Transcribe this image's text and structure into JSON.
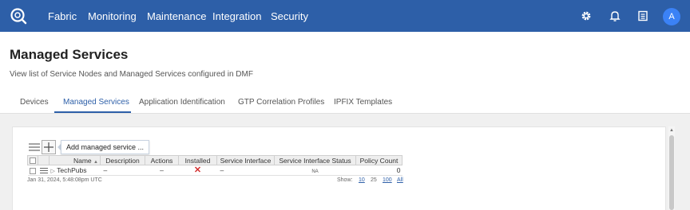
{
  "colors": {
    "accent": "#2d5fa8",
    "topbar": "#2d5fa8",
    "avatar": "#3b82f6",
    "error": "#d32f2f"
  },
  "topbar": {
    "logo_icon": "search-globe-icon",
    "nav": [
      "Fabric",
      "Monitoring",
      "Maintenance",
      "Integration",
      "Security"
    ],
    "icons": [
      "gear-icon",
      "bell-icon",
      "list-icon"
    ],
    "avatar_letter": "A"
  },
  "page": {
    "title": "Managed Services",
    "subtitle": "View list of Service Nodes and Managed Services configured in DMF"
  },
  "tabs": [
    {
      "label": "Devices",
      "active": false
    },
    {
      "label": "Managed Services",
      "active": true
    },
    {
      "label": "Application Identification",
      "active": false
    },
    {
      "label": "GTP Correlation Profiles",
      "active": false
    },
    {
      "label": "IPFIX Templates",
      "active": false
    }
  ],
  "toolbar": {
    "menu_icon": "hamburger-icon",
    "add_icon": "plus-icon",
    "tooltip": "Add managed service ..."
  },
  "table": {
    "columns": [
      "Name",
      "Description",
      "Actions",
      "Installed",
      "Service Interface",
      "Service Interface Status",
      "Policy Count"
    ],
    "sort_column": "Name",
    "rows": [
      {
        "name": "TechPubs",
        "description": "–",
        "actions": "–",
        "installed": "✕",
        "service_interface": "–",
        "service_interface_status": "NA",
        "policy_count": "0"
      }
    ]
  },
  "footer": {
    "timestamp": "Jan 31, 2024, 5:48:08pm UTC",
    "show_label": "Show:",
    "page_sizes": [
      "10",
      "25",
      "100",
      "All"
    ],
    "current_page_size": "25"
  }
}
